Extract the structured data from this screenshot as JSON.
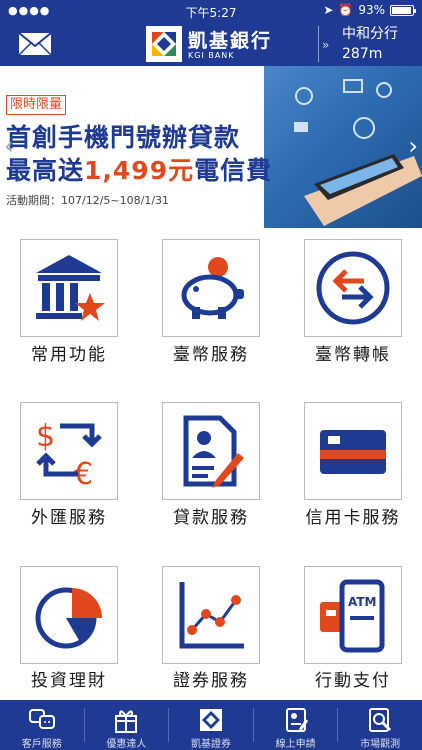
{
  "status_bar": {
    "time": "下午5:27",
    "battery": "93%",
    "battery_level": 0.93
  },
  "header": {
    "bank_name": "凱基銀行",
    "bank_name_en": "KGI BANK",
    "branch_name": "中和分行",
    "branch_distance": "287m"
  },
  "banner": {
    "tag": "限時限量",
    "line1": "首創手機門號辦貸款",
    "line2_prefix": "最高送",
    "line2_amount": "1,499元",
    "line2_suffix": "電信費",
    "period": "活動期間：107/12/5~108/1/31"
  },
  "grid": {
    "items": [
      {
        "label": "常用功能",
        "icon": "bank-star-icon"
      },
      {
        "label": "臺幣服務",
        "icon": "piggy-bank-icon"
      },
      {
        "label": "臺幣轉帳",
        "icon": "transfer-arrows-icon"
      },
      {
        "label": "外匯服務",
        "icon": "currency-exchange-icon"
      },
      {
        "label": "貸款服務",
        "icon": "loan-document-icon"
      },
      {
        "label": "信用卡服務",
        "icon": "credit-card-icon"
      },
      {
        "label": "投資理財",
        "icon": "pie-chart-icon"
      },
      {
        "label": "證券服務",
        "icon": "line-chart-icon"
      },
      {
        "label": "行動支付",
        "icon": "atm-phone-icon"
      }
    ]
  },
  "tabbar": {
    "items": [
      {
        "label": "客戶服務",
        "icon": "customer-service-icon"
      },
      {
        "label": "優惠達人",
        "icon": "gift-icon"
      },
      {
        "label": "凱基證券",
        "icon": "kgi-logo-icon"
      },
      {
        "label": "線上申請",
        "icon": "online-apply-icon"
      },
      {
        "label": "市場觀測",
        "icon": "market-watch-icon"
      }
    ]
  },
  "colors": {
    "brand_blue": "#1f3a93",
    "accent_orange": "#e2481e"
  }
}
